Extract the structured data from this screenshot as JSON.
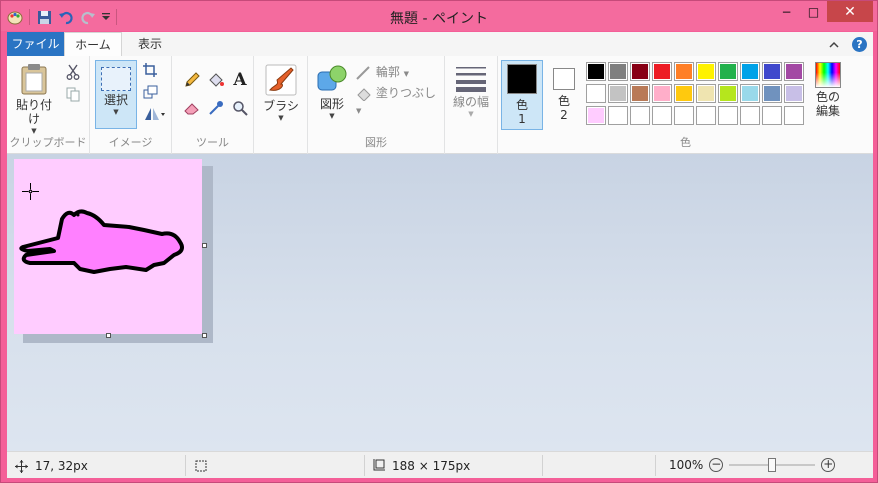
{
  "window": {
    "title": "無題 - ペイント"
  },
  "quick_access": {
    "icons": [
      "paint-app-icon",
      "save-icon",
      "undo-icon",
      "redo-icon",
      "customize-icon"
    ]
  },
  "window_controls": {
    "minimize": "−",
    "maximize": "□",
    "close": "✕"
  },
  "tabs": [
    {
      "label": "ファイル"
    },
    {
      "label": "ホーム"
    },
    {
      "label": "表示"
    }
  ],
  "ribbon": {
    "clipboard": {
      "paste_label": "貼り付け",
      "group_label": "クリップボード"
    },
    "image": {
      "select_label": "選択",
      "group_label": "イメージ"
    },
    "tools": {
      "group_label": "ツール"
    },
    "brushes": {
      "label": "ブラシ"
    },
    "shapes": {
      "shape_label": "図形",
      "outline_label": "輪郭",
      "fill_label": "塗りつぶし",
      "group_label": "図形"
    },
    "size": {
      "label": "線の幅"
    },
    "colors": {
      "color1_label": "色",
      "color1_num": "1",
      "color2_label": "色",
      "color2_num": "2",
      "edit_colors_label_1": "色の",
      "edit_colors_label_2": "編集",
      "group_label": "色",
      "color1_value": "#000000",
      "color2_value": "#ffffff",
      "palette": [
        "#000000",
        "#7f7f7f",
        "#880015",
        "#ed1c24",
        "#ff7f27",
        "#fff200",
        "#22b14c",
        "#00a2e8",
        "#3f48cc",
        "#a349a4",
        "#ffffff",
        "#c3c3c3",
        "#b97a57",
        "#ffaec9",
        "#ffc90e",
        "#efe4b0",
        "#b5e61d",
        "#99d9ea",
        "#7092be",
        "#c8bfe7",
        "#ffccff",
        "#ffffff",
        "#ffffff",
        "#ffffff",
        "#ffffff",
        "#ffffff",
        "#ffffff",
        "#ffffff",
        "#ffffff",
        "#ffffff"
      ]
    }
  },
  "canvas": {
    "background": "#ffccff",
    "drawing_fill": "#ff80ff",
    "drawing_stroke": "#000000"
  },
  "status": {
    "cursor_position": "17, 32px",
    "image_size": "188 × 175px",
    "zoom": "100%",
    "zoom_level": 1.0
  }
}
